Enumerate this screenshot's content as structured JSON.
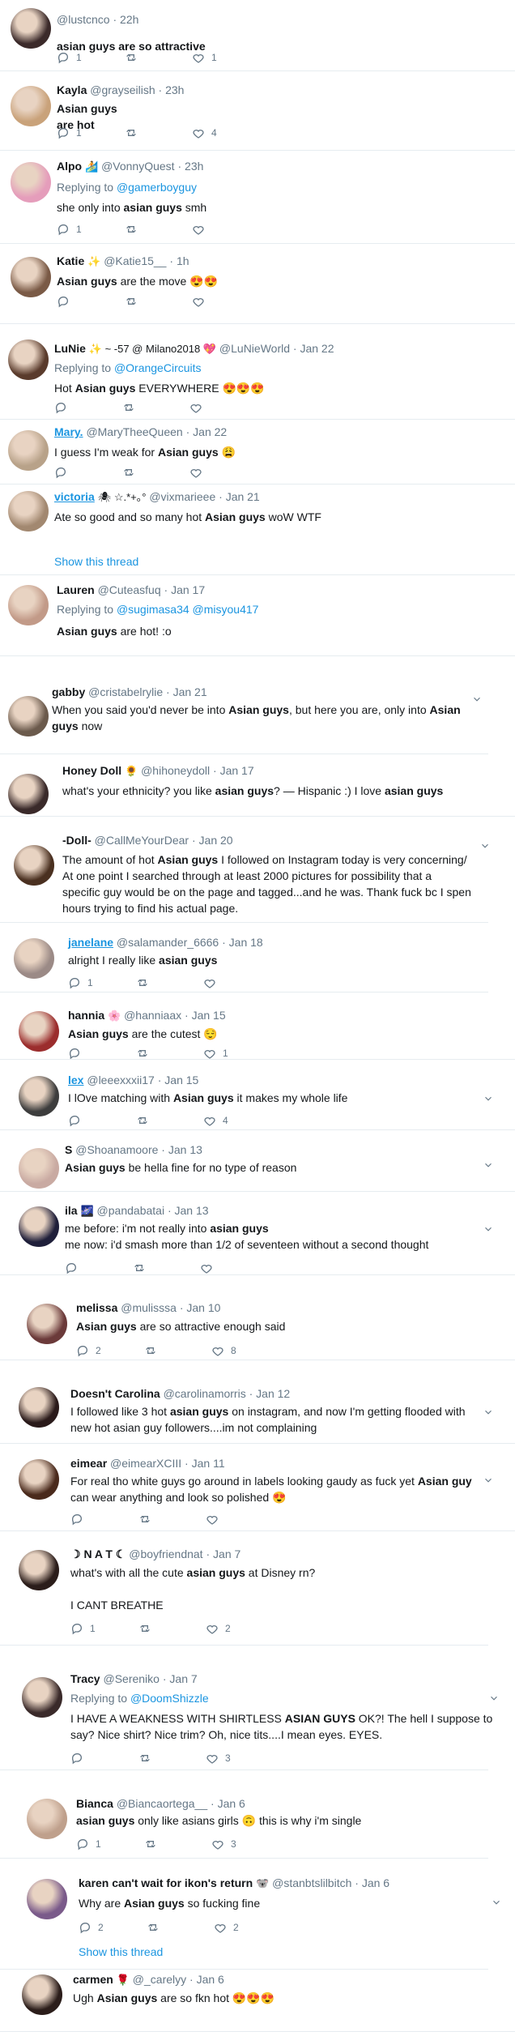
{
  "tweets": [
    {
      "name": "",
      "handle": "@lustcnco",
      "time": "22h",
      "body": [
        [
          "",
          "asian guys are so attractive",
          ""
        ]
      ],
      "counts": {
        "reply": "1",
        "retweet": "",
        "like": "1"
      }
    },
    {
      "name": "Kayla",
      "handle": "@grayseilish",
      "time": "23h",
      "body": [
        [
          "",
          "Asian guys",
          ""
        ],
        [
          "",
          "are hot",
          ""
        ]
      ],
      "counts": {
        "reply": "1",
        "retweet": "",
        "like": "4"
      }
    },
    {
      "name": "Alpo",
      "name_emoji": "🏄",
      "handle": "@VonnyQuest",
      "time": "23h",
      "reply_label": "Replying to",
      "reply_to": "@gamerboyguy",
      "body": [
        [
          "she only into ",
          "asian guys",
          " smh"
        ]
      ],
      "counts": {
        "reply": "1",
        "retweet": "",
        "like": ""
      }
    },
    {
      "name": "Katie",
      "name_emoji": "✨",
      "handle": "@Katie15__",
      "time": "1h",
      "body": [
        [
          "",
          "Asian guys",
          " are the move 😍😍"
        ]
      ],
      "counts": {
        "reply": "",
        "retweet": "",
        "like": ""
      }
    },
    {
      "name": "LuNie",
      "name_emoji": "✨ ~ -57 @ Milano2018 💖",
      "handle": "@LuNieWorld",
      "time": "Jan 22",
      "reply_label": "Replying to",
      "reply_to": "@OrangeCircuits",
      "body": [
        [
          "Hot ",
          "Asian guys",
          " EVERYWHERE 😍😍😍"
        ]
      ],
      "counts": {
        "reply": "",
        "retweet": "",
        "like": ""
      }
    },
    {
      "name": "Mary.",
      "handle": "@MaryTheeQueen",
      "time": "Jan 22",
      "body": [
        [
          "I guess I'm weak for ",
          "Asian guys",
          " 😩"
        ]
      ],
      "counts": {
        "reply": "",
        "retweet": "",
        "like": ""
      }
    },
    {
      "name": "victoria",
      "name_emoji": "🕷 ☆.*+｡°",
      "handle": "@vixmarieee",
      "time": "Jan 21",
      "body": [
        [
          "Ate so good and so many hot ",
          "Asian guys",
          " woW WTF"
        ]
      ],
      "show_thread": "Show this thread"
    },
    {
      "name": "Lauren",
      "handle": "@Cuteasfuq",
      "time": "Jan 17",
      "reply_label": "Replying to",
      "reply_to": "@sugimasa34 @misyou417",
      "body": [
        [
          "",
          "Asian guys",
          " are hot! :o"
        ]
      ]
    },
    {
      "name": "gabby",
      "handle": "@cristabelrylie",
      "time": "Jan 21",
      "body": [
        [
          "When you said you'd never be into ",
          "Asian guys",
          ", but here you are, only into ",
          "Asian"
        ],
        [
          "",
          "guys",
          " now"
        ]
      ]
    },
    {
      "name": "Honey Doll",
      "name_emoji": "🌻",
      "handle": "@hihoneydoll",
      "time": "Jan 17",
      "body": [
        [
          "what's your ethnicity? you like ",
          "asian guys",
          "? — Hispanic :) I love ",
          "asian guys"
        ]
      ]
    },
    {
      "name": "-Doll-",
      "handle": "@CallMeYourDear",
      "time": "Jan 20",
      "body": [
        [
          "The amount of hot ",
          "Asian guys",
          " I followed on Instagram today is very concerning/"
        ],
        [
          "At one point I searched through at least 2000 pictures for possibility that a",
          ""
        ],
        [
          "specific guy would be on the page and tagged...and he was. Thank fuck bc I spen",
          ""
        ],
        [
          "hours trying to find his actual page.",
          ""
        ]
      ]
    },
    {
      "name": "janelane",
      "handle": "@salamander_6666",
      "time": "Jan 18",
      "body": [
        [
          "alright I really like ",
          "asian guys",
          ""
        ]
      ],
      "counts": {
        "reply": "1",
        "retweet": "",
        "like": ""
      }
    },
    {
      "name": "hannia",
      "name_emoji": "🌸",
      "handle": "@hanniaax",
      "time": "Jan 15",
      "body": [
        [
          "",
          "Asian guys",
          " are the cutest 😌"
        ]
      ],
      "counts": {
        "reply": "",
        "retweet": "",
        "like": "1"
      }
    },
    {
      "name": "lex",
      "handle": "@leeexxxii17",
      "time": "Jan 15",
      "body": [
        [
          "I lOve matching with ",
          "Asian guys",
          " it makes my whole life"
        ]
      ],
      "counts": {
        "reply": "",
        "retweet": "",
        "like": "4"
      }
    },
    {
      "name": "S",
      "handle": "@Shoanamoore",
      "time": "Jan 13",
      "body": [
        [
          "",
          "Asian guys",
          " be hella fine for no type of reason"
        ]
      ]
    },
    {
      "name": "ila",
      "name_emoji": "🌌",
      "handle": "@pandabatai",
      "time": "Jan 13",
      "body": [
        [
          "me before: i'm not really into ",
          "asian guys",
          ""
        ],
        [
          "me now: i'd smash more than 1/2 of seventeen without a second thought",
          ""
        ]
      ]
    },
    {
      "name": "melissa",
      "handle": "@mulisssa",
      "time": "Jan 10",
      "body": [
        [
          "",
          "Asian guys",
          " are so attractive enough said"
        ]
      ],
      "counts": {
        "reply": "2",
        "retweet": "",
        "like": "8"
      }
    },
    {
      "name": "Doesn't Carolina",
      "handle": "@carolinamorris",
      "time": "Jan 12",
      "body": [
        [
          "I followed like 3 hot ",
          "asian guys",
          " on instagram, and now I'm getting flooded with"
        ],
        [
          "new hot asian guy followers....im not complaining",
          ""
        ]
      ]
    },
    {
      "name": "eimear",
      "handle": "@eimearXCIII",
      "time": "Jan 11",
      "body": [
        [
          "For real tho white guys go around in labels looking gaudy as fuck yet ",
          "Asian guy",
          ""
        ],
        [
          "can wear anything and look so polished 😍",
          ""
        ]
      ]
    },
    {
      "name": "☽ N A T ☾",
      "handle": "@boyfriendnat",
      "time": "Jan 7",
      "body": [
        [
          "what's with all the cute ",
          "asian guys",
          " at Disney rn?"
        ],
        [
          "",
          ""
        ],
        [
          "I CANT BREATHE",
          ""
        ]
      ],
      "counts": {
        "reply": "1",
        "retweet": "",
        "like": "2"
      }
    },
    {
      "name": "Tracy",
      "handle": "@Sereniko",
      "time": "Jan 7",
      "reply_label": "Replying to",
      "reply_to": "@DoomShizzle",
      "body": [
        [
          "I HAVE A WEAKNESS WITH SHIRTLESS ",
          "ASIAN GUYS",
          " OK?! The hell I suppose to"
        ],
        [
          "say? Nice shirt? Nice trim? Oh, nice tits....I mean eyes. EYES.",
          ""
        ]
      ],
      "counts": {
        "reply": "",
        "retweet": "",
        "like": "3"
      }
    },
    {
      "name": "Bianca",
      "handle": "@Biancaortega__",
      "time": "Jan 6",
      "body": [
        [
          "",
          "asian guys",
          " only like asians girls 🙃 this is why i'm single"
        ]
      ],
      "counts": {
        "reply": "1",
        "retweet": "",
        "like": "3"
      }
    },
    {
      "name": "karen can't wait for ikon's return",
      "name_emoji": "🐨",
      "handle": "@stanbtslilbitch",
      "time": "Jan 6",
      "body": [
        [
          "Why are ",
          "Asian guys",
          " so fucking fine"
        ]
      ],
      "counts": {
        "reply": "2",
        "retweet": "",
        "like": "2"
      },
      "show_thread": "Show this thread"
    },
    {
      "name": "carmen",
      "name_emoji": "🌹",
      "handle": "@_carelyy",
      "time": "Jan 6",
      "body": [
        [
          "Ugh ",
          "Asian guys",
          " are so fkn hot 😍😍😍"
        ]
      ]
    }
  ],
  "colors": {
    "link": "#1b95e0",
    "muted": "#657786",
    "text": "#14171a",
    "border": "#e6ecf0"
  },
  "icons": {
    "reply": "reply-icon",
    "retweet": "retweet-icon",
    "like": "like-icon",
    "menu": "chevron-down-icon"
  }
}
